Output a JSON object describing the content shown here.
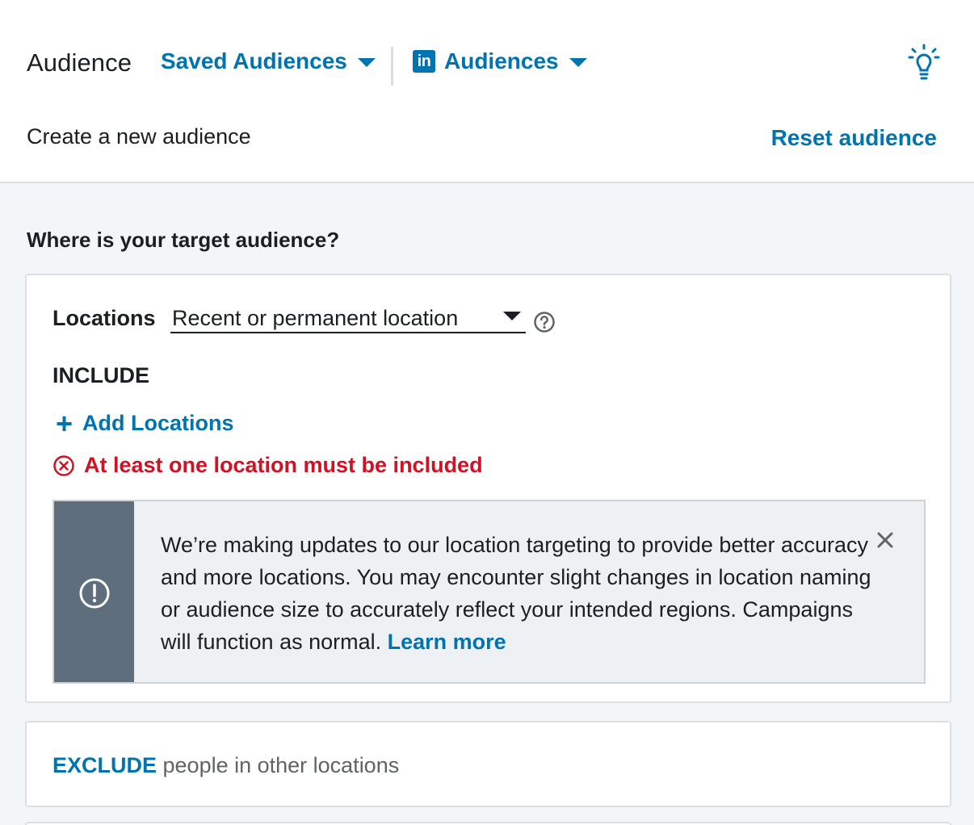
{
  "header": {
    "title": "Audience",
    "saved_audiences_label": "Saved Audiences",
    "linkedin_logo_text": "in",
    "audiences_label": "Audiences",
    "subtitle": "Create a new audience",
    "reset_label": "Reset audience"
  },
  "locations_section": {
    "question": "Where is your target audience?",
    "locations_label": "Locations",
    "location_type_value": "Recent or permanent location",
    "include_label": "INCLUDE",
    "add_locations_label": "Add Locations",
    "error_text": "At least one location must be included",
    "notice": {
      "message": "We’re making updates to our location targeting to provide better accuracy and more locations. You may encounter slight changes in location naming or audience size to accurately reflect your intended regions. Campaigns will function as normal. ",
      "learn_more_label": "Learn more"
    }
  },
  "exclude_section": {
    "keyword": "EXCLUDE",
    "rest": " people in other locations"
  },
  "colors": {
    "brand_blue": "#0073b1",
    "error_red": "#d11124",
    "notice_side": "#5e6e7c",
    "page_bg": "#f3f6f8"
  },
  "icons": {
    "caret": "caret-down-icon",
    "bulb": "lightbulb-icon",
    "help": "question-circle-icon",
    "plus": "plus-icon",
    "error": "error-circle-x-icon",
    "notice": "exclamation-circle-icon",
    "close": "close-icon"
  }
}
